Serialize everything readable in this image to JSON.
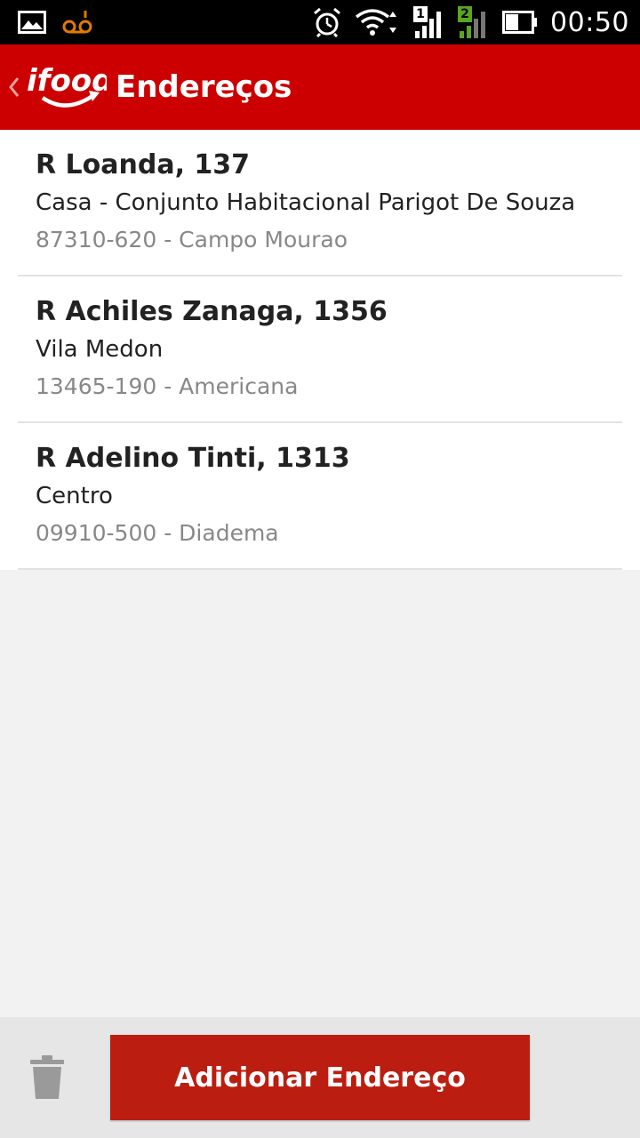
{
  "status_bar": {
    "time": "00:50",
    "icons": [
      "gallery-icon",
      "voicemail-icon",
      "alarm-icon",
      "wifi-icon",
      "sim1-signal-icon",
      "sim2-signal-icon",
      "battery-icon"
    ],
    "sim1_label": "1",
    "sim2_label": "2"
  },
  "app_bar": {
    "logo_text": "ifood",
    "title": "Endereços",
    "color": "#cc0000"
  },
  "addresses": [
    {
      "street": "R Loanda, 137",
      "neighborhood": "Casa - Conjunto Habitacional Parigot De Souza",
      "zip_city": "87310-620 - Campo Mourao"
    },
    {
      "street": "R Achiles Zanaga, 1356",
      "neighborhood": "Vila Medon",
      "zip_city": "13465-190 - Americana"
    },
    {
      "street": "R Adelino Tinti, 1313",
      "neighborhood": "Centro",
      "zip_city": "09910-500 - Diadema"
    }
  ],
  "bottom_bar": {
    "add_button_label": "Adicionar Endereço",
    "button_color": "#bb1e10",
    "delete_icon": "trash-icon"
  }
}
